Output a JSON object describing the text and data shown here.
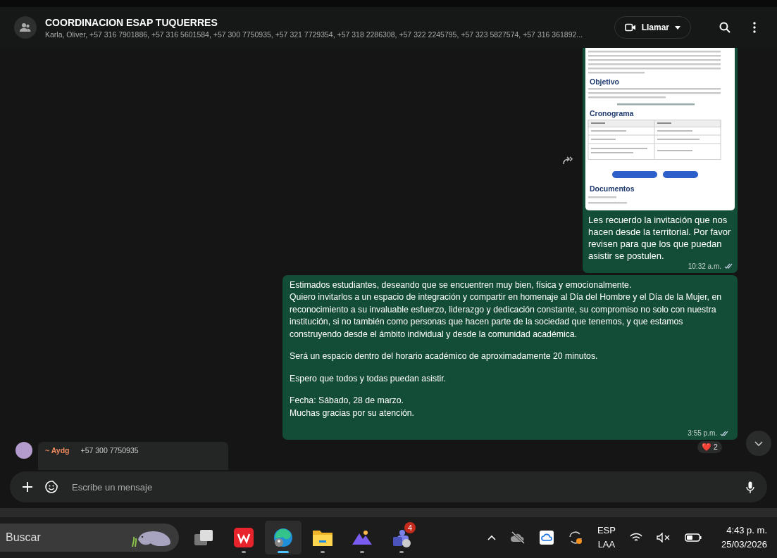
{
  "header": {
    "title": "COORDINACION ESAP TUQUERRES",
    "subtitle": "Karla, Oliver, +57 316 7901886, +57 316 5601584, +57 300 7750935, +57 321 7729354, +57 318 2286308, +57 322 2245795, +57 323 5827574, +57 316 361892...",
    "call_label": "Llamar"
  },
  "messages": [
    {
      "kind": "image",
      "headings": [
        "Objetivo",
        "Cronograma",
        "Documentos"
      ],
      "text": "Les recuerdo la invitación que nos hacen desde la territorial. Por favor revisen para que los que puedan asistir se postulen.",
      "time": "10:32 a.m.",
      "read": true
    },
    {
      "kind": "text",
      "paragraphs": [
        "Estimados estudiantes, deseando que se encuentren muy bien, física y emocionalmente.\nQuiero invitarlos a un espacio de integración y compartir en homenaje al Día del Hombre y el Día de la Mujer,  en reconocimiento a su invaluable esfuerzo, liderazgo y dedicación constante, su compromiso  no solo con nuestra institución, si no también como personas que hacen parte de la sociedad que tenemos, y que estamos construyendo desde el ámbito individual y desde la comunidad académica.",
        "Será un espacio dentro del horario académico de aproximadamente 20 minutos.",
        "Espero que todos y todas puedan asistir.",
        "Fecha: Sábado, 28 de marzo.\nMuchas gracias por su atención."
      ],
      "time": "3:55 p.m.",
      "read": true,
      "reaction": {
        "emoji": "❤️",
        "count": "2"
      }
    }
  ],
  "incoming": {
    "sender": "~ Aydg",
    "phone": "+57 300 7750935"
  },
  "composer": {
    "placeholder": "Escribe un mensaje"
  },
  "taskbar": {
    "search_placeholder": "Buscar",
    "apps": [
      {
        "kind": "taskview",
        "selected": false,
        "running": false
      },
      {
        "kind": "wps",
        "selected": false,
        "running": true
      },
      {
        "kind": "edge",
        "selected": true,
        "running": true
      },
      {
        "kind": "files",
        "selected": false,
        "running": true
      },
      {
        "kind": "mountain",
        "selected": false,
        "running": true
      },
      {
        "kind": "teams",
        "selected": false,
        "running": true,
        "badge": "4"
      }
    ],
    "language": [
      "ESP",
      "LAA"
    ],
    "time": "4:43 p. m.",
    "date": "25/03/2026"
  }
}
